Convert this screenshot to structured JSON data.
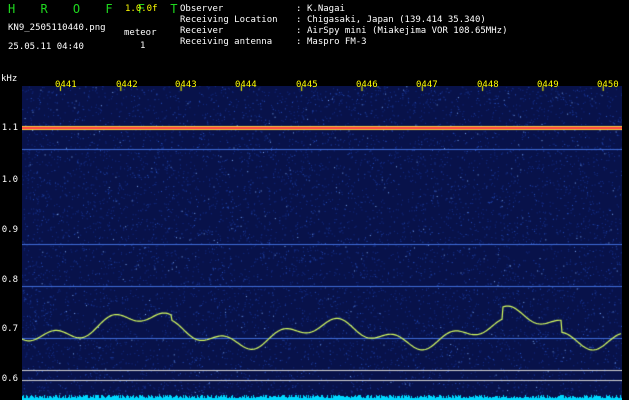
{
  "header": {
    "logo": "H R O F F T",
    "version": "1.0.0f",
    "filename": "KN9_2505110440.png",
    "datetime": "25.05.11 04:40",
    "meteor_label": "meteor",
    "meteor_count": "1",
    "rows": [
      {
        "label": "Observer",
        "value": "K.Nagai"
      },
      {
        "label": "Receiving Location",
        "value": "Chigasaki, Japan (139.414 35.340)"
      },
      {
        "label": "Receiver",
        "value": "AirSpy mini (Miakejima VOR 108.65MHz)"
      },
      {
        "label": "Receiving antenna",
        "value": "Maspro FM-3"
      }
    ],
    "sep": ":"
  },
  "axis": {
    "unit": "kHz",
    "y_ticks": [
      "1.1",
      "1.0",
      "0.9",
      "0.8",
      "0.7",
      "0.6"
    ],
    "time_ticks": [
      "0441",
      "0442",
      "0443",
      "0444",
      "0445",
      "0446",
      "0447",
      "0448",
      "0449",
      "0450"
    ]
  },
  "colors": {
    "background": "#08124a",
    "carrier": "#ff4040",
    "trace": "#d8ff60",
    "baseline": "#00d8ff"
  }
}
